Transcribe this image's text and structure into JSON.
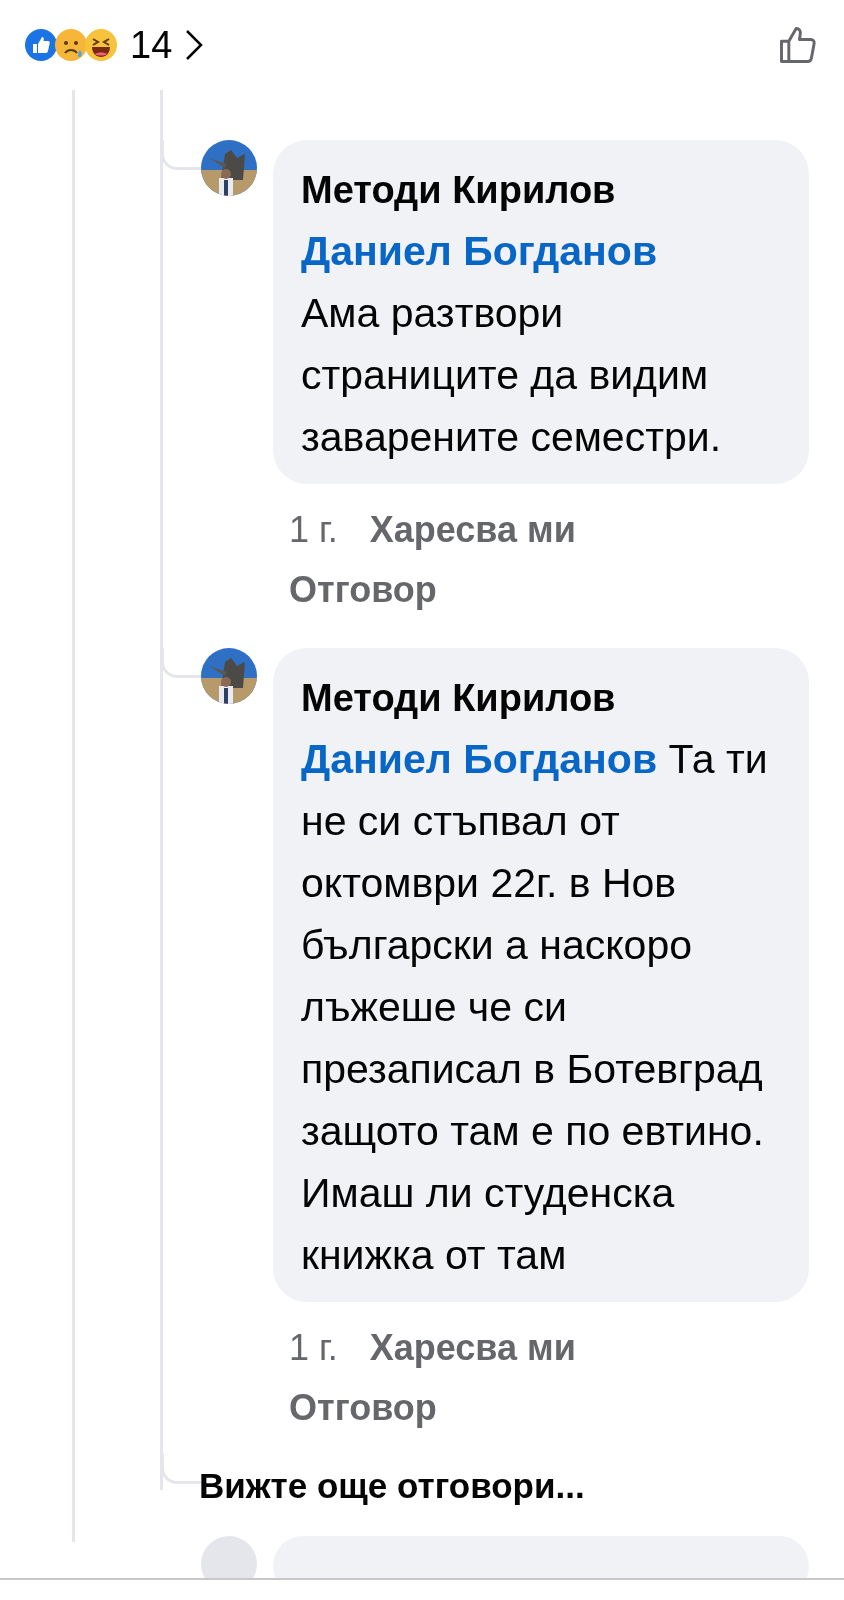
{
  "reactions": {
    "count": "14"
  },
  "replies": [
    {
      "author": "Методи Кирилов",
      "mention": "Даниел Богданов",
      "text": "Ама разтвори страниците да видим заварените семестри.",
      "time": "1 г.",
      "like": "Харесва ми",
      "reply": "Отговор"
    },
    {
      "author": "Методи Кирилов",
      "mention": "Даниел Богданов",
      "text": "Та ти не си стъпвал от октомври 22г. в Нов български а наскоро лъжеше че си презаписал в Ботевград защото там е по евтино. Имаш ли студенска книжка от там",
      "time": "1 г.",
      "like": "Харесва ми",
      "reply": "Отговор"
    }
  ],
  "more_replies": "Вижте още отговори..."
}
